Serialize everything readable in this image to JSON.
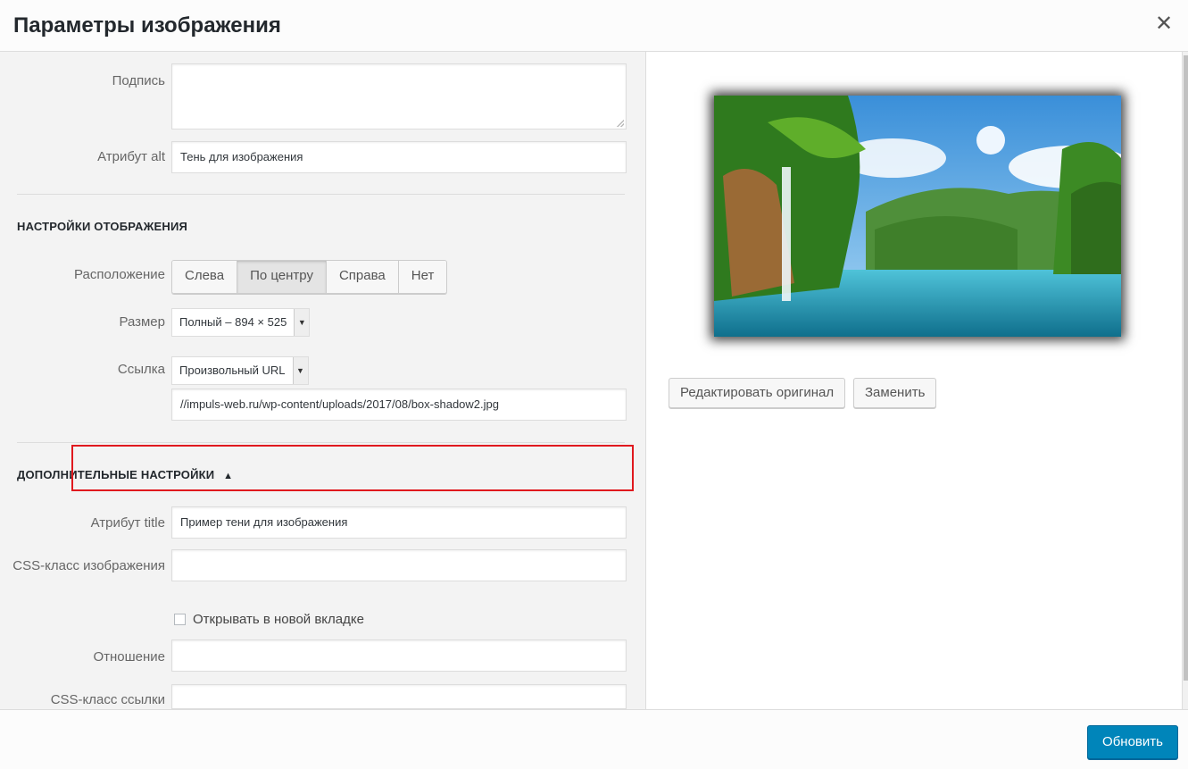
{
  "modal": {
    "title": "Параметры изображения",
    "close_icon": "close-icon"
  },
  "fields": {
    "caption": {
      "label": "Подпись",
      "value": ""
    },
    "alt": {
      "label": "Атрибут alt",
      "value": "Тень для изображения"
    }
  },
  "display": {
    "section_title": "НАСТРОЙКИ ОТОБРАЖЕНИЯ",
    "align_label": "Расположение",
    "align_options": [
      "Слева",
      "По центру",
      "Справа",
      "Нет"
    ],
    "align_selected": "По центру",
    "size_label": "Размер",
    "size_value": "Полный – 894 × 525",
    "link_label": "Ссылка",
    "link_value": "Произвольный URL",
    "link_url": "//impuls-web.ru/wp-content/uploads/2017/08/box-shadow2.jpg"
  },
  "advanced": {
    "section_title": "ДОПОЛНИТЕЛЬНЫЕ НАСТРОЙКИ",
    "toggle_icon": "triangle-up-icon",
    "title_attr_label": "Атрибут title",
    "title_attr_value": "Пример тени для изображения",
    "css_class_label": "CSS-класс изображения",
    "css_class_value": "",
    "new_tab_label": "Открывать в новой вкладке",
    "new_tab_checked": false,
    "rel_label": "Отношение",
    "rel_value": "",
    "link_css_label": "CSS-класс ссылки",
    "link_css_value": ""
  },
  "preview": {
    "edit_original": "Редактировать оригинал",
    "replace": "Заменить"
  },
  "footer": {
    "update": "Обновить"
  },
  "colors": {
    "accent": "#0085ba",
    "highlight": "#e0191e"
  }
}
